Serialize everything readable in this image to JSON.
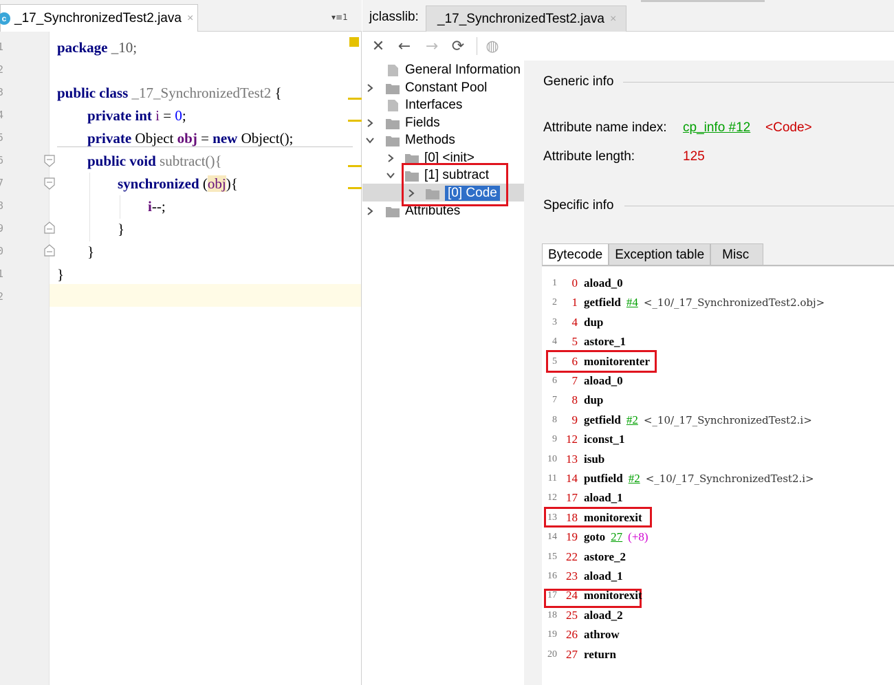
{
  "editor": {
    "tab_title": "_17_SynchronizedTest2.java",
    "tab_close": "×",
    "tab_icon_letter": "c",
    "tab_menu": "▾≡1",
    "line_numbers": [
      "1",
      "2",
      "3",
      "4",
      "5",
      "6",
      "7",
      "8",
      "9",
      "0",
      "1",
      "2"
    ],
    "code": {
      "l1_kw": "package",
      "l1_rest": " _10;",
      "l3_kw1": "public",
      "l3_kw2": "class",
      "l3_name": "_17_SynchronizedTest2",
      "l3_brace": " {",
      "l4_kw1": "private",
      "l4_kw2": "int",
      "l4_field": " i",
      "l4_eq": " = ",
      "l4_num": "0",
      "l4_semi": ";",
      "l5_kw1": "private",
      "l5_type": " Object ",
      "l5_field": "obj",
      "l5_eq": " = ",
      "l5_kw2": "new",
      "l5_rest": " Object();",
      "l6_kw1": "public",
      "l6_kw2": "void",
      "l6_name": " subtract(){",
      "l7_kw": "synchronized",
      "l7_open": " (",
      "l7_obj": "obj",
      "l7_close": "){",
      "l8_field": "i",
      "l8_rest": "--;",
      "l9": "}",
      "l10": "}",
      "l11": "}"
    }
  },
  "jclasslib": {
    "label": "jclasslib:",
    "tab_title": "_17_SynchronizedTest2.java",
    "tab_close": "×",
    "toolbar": {
      "close": "✕",
      "back": "←",
      "forward": "→",
      "refresh": "⟳",
      "web": "◍"
    },
    "tree": {
      "general": "General Information",
      "constant_pool": "Constant Pool",
      "interfaces": "Interfaces",
      "fields": "Fields",
      "methods": "Methods",
      "method_init": "[0] <init>",
      "method_subtract": "[1] subtract",
      "code": "[0] Code",
      "attributes": "Attributes"
    },
    "details": {
      "generic_info": "Generic info",
      "attr_name_index_label": "Attribute name index:",
      "attr_name_index_link": "cp_info #12",
      "attr_name_index_value": "<Code>",
      "attr_length_label": "Attribute length:",
      "attr_length_value": "125",
      "specific_info": "Specific info",
      "tabs": [
        "Bytecode",
        "Exception table",
        "Misc"
      ]
    },
    "bytecode": [
      {
        "line": "1",
        "offset": "0",
        "op": "aload_0"
      },
      {
        "line": "2",
        "offset": "1",
        "op": "getfield",
        "link": "#4",
        "comment": "<_10/_17_SynchronizedTest2.obj>"
      },
      {
        "line": "3",
        "offset": "4",
        "op": "dup"
      },
      {
        "line": "4",
        "offset": "5",
        "op": "astore_1"
      },
      {
        "line": "5",
        "offset": "6",
        "op": "monitorenter"
      },
      {
        "line": "6",
        "offset": "7",
        "op": "aload_0"
      },
      {
        "line": "7",
        "offset": "8",
        "op": "dup"
      },
      {
        "line": "8",
        "offset": "9",
        "op": "getfield",
        "link": "#2",
        "comment": "<_10/_17_SynchronizedTest2.i>"
      },
      {
        "line": "9",
        "offset": "12",
        "op": "iconst_1"
      },
      {
        "line": "10",
        "offset": "13",
        "op": "isub"
      },
      {
        "line": "11",
        "offset": "14",
        "op": "putfield",
        "link": "#2",
        "comment": "<_10/_17_SynchronizedTest2.i>"
      },
      {
        "line": "12",
        "offset": "17",
        "op": "aload_1"
      },
      {
        "line": "13",
        "offset": "18",
        "op": "monitorexit"
      },
      {
        "line": "14",
        "offset": "19",
        "op": "goto",
        "link": "27",
        "extra": "(+8)"
      },
      {
        "line": "15",
        "offset": "22",
        "op": "astore_2"
      },
      {
        "line": "16",
        "offset": "23",
        "op": "aload_1"
      },
      {
        "line": "17",
        "offset": "24",
        "op": "monitorexit"
      },
      {
        "line": "18",
        "offset": "25",
        "op": "aload_2"
      },
      {
        "line": "19",
        "offset": "26",
        "op": "athrow"
      },
      {
        "line": "20",
        "offset": "27",
        "op": "return"
      }
    ]
  },
  "colors": {
    "keyword": "#000080",
    "field": "#660e7a",
    "link_green": "#00a000",
    "offset_red": "#cc0000",
    "highlight_box": "#e0141e",
    "selection_blue": "#2f6fc8"
  }
}
